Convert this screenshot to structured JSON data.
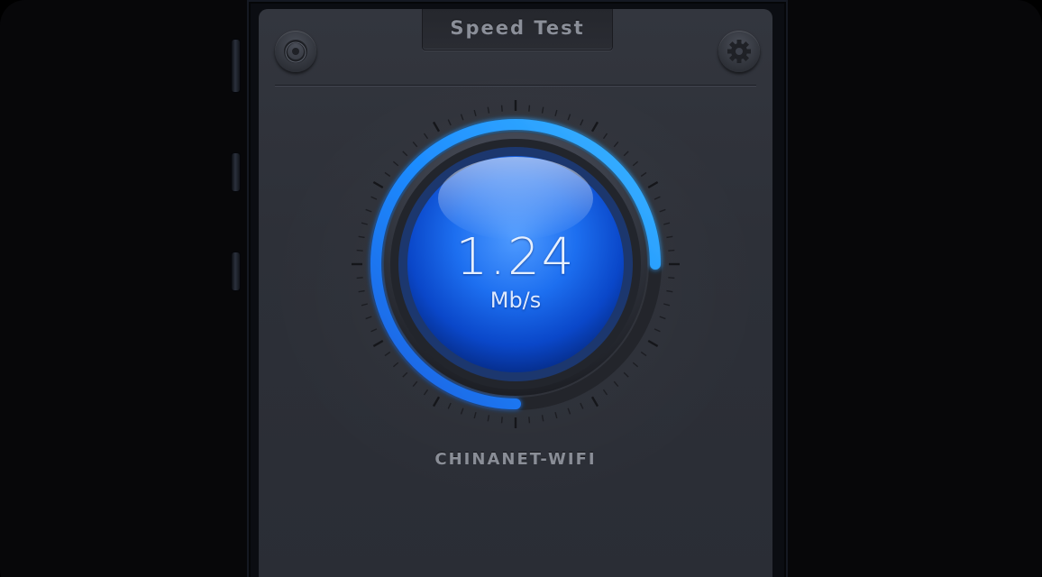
{
  "app": {
    "title": "Speed Test"
  },
  "toolbar": {
    "left_icon": "target-icon",
    "right_icon": "gear-icon"
  },
  "gauge": {
    "speed_value": "1.24",
    "speed_unit": "Mb/s",
    "progress_fraction": 0.75,
    "accent_color": "#1e90ff",
    "ring_color": "#1565e8"
  },
  "network": {
    "name": "CHINANET-WIFI"
  }
}
